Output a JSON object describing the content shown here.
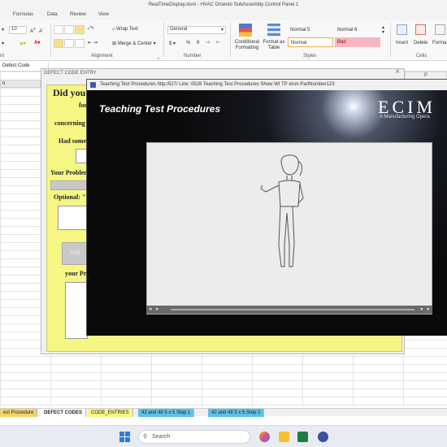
{
  "window": {
    "title": "RealTimeDisplay.xlsm  -  HVAC Orlando SubAssembly Control Panel 1"
  },
  "menu": {
    "items": [
      "Formulas",
      "Data",
      "Review",
      "View"
    ]
  },
  "ribbon": {
    "font_size": "10",
    "wrap_text": "Wrap Text",
    "merge_center": "Merge & Center",
    "number_format": "General",
    "conditional_formatting": "Conditional Formatting",
    "format_as_table": "Format as Table",
    "styles": {
      "normal5": "Normal 5",
      "normal6": "Normal 6",
      "normal": "Normal",
      "bad": "Bad"
    },
    "cells": {
      "insert": "Insert",
      "delete": "Delete",
      "format": "Forma"
    },
    "groups": {
      "font_tail": "nt",
      "alignment": "Alignment",
      "number": "Number",
      "styles": "Styles",
      "cells": "Cells"
    },
    "colors": {
      "bad_fill": "#f4b6c3",
      "normal_border": "#e0b34a"
    }
  },
  "sheet": {
    "namebox": "Defect Code",
    "col_p": "P",
    "row_frag": "n"
  },
  "defect_form": {
    "title": "DEFECT CODE ENTRY",
    "heading": "Did you",
    "line_for": "for",
    "line_concerning": "concerning",
    "line_had_some": "Had some",
    "problem_label": "Your Problem",
    "optional_label": "Optional: \"",
    "add_label": "Add",
    "your_pr_label": "your Pr",
    "panel_color": "#f6f684"
  },
  "video_window": {
    "title": "Teaching Test Procedures http:/527/ Line: 0528 Teaching Test Procedures Show WI TP xlsm PartNumber123",
    "heading": "Teaching Test Procedures",
    "logo": "ECIM",
    "logo_sub": "A Manufacturing Opera"
  },
  "sheet_tabs": [
    {
      "label": "est Procedure",
      "color": "#f2d36b"
    },
    {
      "label": "DEFECT CODES",
      "color": "#ffffff"
    },
    {
      "label": "CODE_ENTRIES",
      "color": "#f6f684"
    },
    {
      "label": "42 and 48 5 x 5 Step 1",
      "color": "#5bc3e8"
    },
    {
      "label": "42 and 48 5 x 5 Step 2",
      "color": "#5bc3e8"
    }
  ],
  "taskbar": {
    "search_placeholder": "Search"
  }
}
